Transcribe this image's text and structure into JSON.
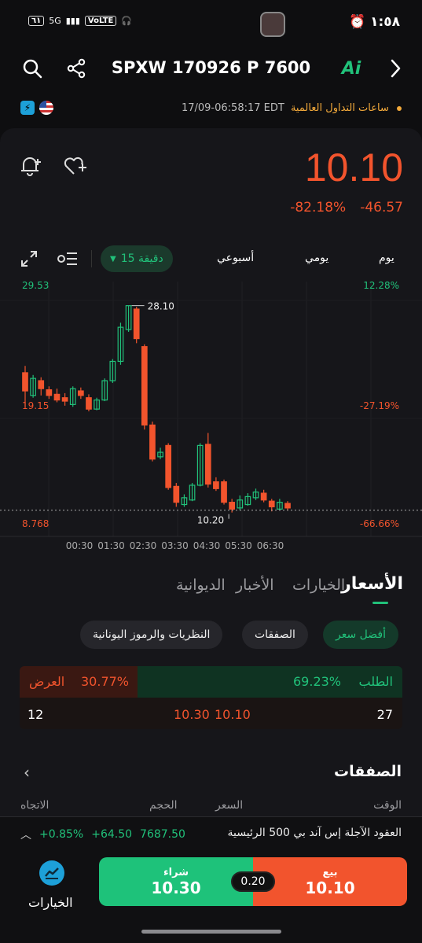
{
  "status_bar": {
    "time": "١:٥٨",
    "battery": "٦١",
    "network": "5G",
    "volte": "VoLTE"
  },
  "header": {
    "title": "SPXW 170926 P 7600",
    "ai_label": "Ai"
  },
  "market": {
    "status": "ساعات التداول العالمية",
    "timestamp": "17/09-06:58:17 EDT"
  },
  "quote": {
    "price": "10.10",
    "change": "-46.57",
    "change_pct": "-82.18%"
  },
  "chart_controls": {
    "active_timeframe": "15 دقيقة",
    "timeframes": [
      "يوم",
      "يومي",
      "أسبوعي"
    ]
  },
  "chart_data": {
    "type": "candlestick",
    "y_left_labels": [
      "29.53",
      "19.15",
      "8.768"
    ],
    "y_right_labels": [
      "12.28%",
      "-27.19%",
      "-66.66%"
    ],
    "x_labels": [
      "00:30",
      "01:30",
      "02:30",
      "03:30",
      "04:30",
      "05:30",
      "06:30"
    ],
    "high_marker": "28.10",
    "low_marker": "10.20",
    "last_price": 10.1,
    "ylim": [
      8.768,
      29.53
    ],
    "candles": [
      {
        "o": 22.2,
        "c": 20.6,
        "h": 22.8,
        "l": 19.2
      },
      {
        "o": 20.2,
        "c": 21.7,
        "h": 22.0,
        "l": 20.0
      },
      {
        "o": 21.5,
        "c": 20.8,
        "h": 21.8,
        "l": 20.2
      },
      {
        "o": 20.7,
        "c": 20.2,
        "h": 21.0,
        "l": 19.9
      },
      {
        "o": 20.3,
        "c": 19.8,
        "h": 20.8,
        "l": 19.6
      },
      {
        "o": 20.0,
        "c": 19.7,
        "h": 20.4,
        "l": 19.3
      },
      {
        "o": 19.4,
        "c": 20.8,
        "h": 21.0,
        "l": 19.2
      },
      {
        "o": 20.6,
        "c": 20.2,
        "h": 20.9,
        "l": 19.9
      },
      {
        "o": 20.0,
        "c": 19.0,
        "h": 20.3,
        "l": 18.8
      },
      {
        "o": 19.0,
        "c": 19.8,
        "h": 20.0,
        "l": 18.9
      },
      {
        "o": 19.8,
        "c": 21.5,
        "h": 21.7,
        "l": 19.7
      },
      {
        "o": 21.5,
        "c": 23.2,
        "h": 23.4,
        "l": 21.3
      },
      {
        "o": 23.2,
        "c": 26.2,
        "h": 26.6,
        "l": 22.9
      },
      {
        "o": 26.0,
        "c": 28.1,
        "h": 28.1,
        "l": 25.8
      },
      {
        "o": 27.8,
        "c": 25.2,
        "h": 28.0,
        "l": 24.8
      },
      {
        "o": 24.5,
        "c": 17.6,
        "h": 24.7,
        "l": 17.2
      },
      {
        "o": 17.6,
        "c": 14.6,
        "h": 17.9,
        "l": 14.4
      },
      {
        "o": 14.8,
        "c": 15.2,
        "h": 15.6,
        "l": 14.6
      },
      {
        "o": 15.8,
        "c": 12.1,
        "h": 16.0,
        "l": 11.9
      },
      {
        "o": 12.2,
        "c": 10.8,
        "h": 12.5,
        "l": 10.4
      },
      {
        "o": 10.6,
        "c": 11.2,
        "h": 11.5,
        "l": 10.4
      },
      {
        "o": 11.0,
        "c": 12.3,
        "h": 12.5,
        "l": 10.9
      },
      {
        "o": 12.3,
        "c": 15.8,
        "h": 16.0,
        "l": 12.2
      },
      {
        "o": 15.9,
        "c": 12.4,
        "h": 16.9,
        "l": 12.1
      },
      {
        "o": 12.6,
        "c": 12.0,
        "h": 13.0,
        "l": 11.8
      },
      {
        "o": 12.6,
        "c": 10.8,
        "h": 12.8,
        "l": 10.6
      },
      {
        "o": 10.8,
        "c": 10.2,
        "h": 11.1,
        "l": 9.9
      },
      {
        "o": 10.3,
        "c": 11.0,
        "h": 11.4,
        "l": 10.1
      },
      {
        "o": 10.6,
        "c": 11.3,
        "h": 11.6,
        "l": 10.5
      },
      {
        "o": 11.2,
        "c": 11.7,
        "h": 12.0,
        "l": 11.0
      },
      {
        "o": 11.6,
        "c": 11.0,
        "h": 11.9,
        "l": 10.8
      },
      {
        "o": 10.9,
        "c": 10.4,
        "h": 11.1,
        "l": 10.0
      },
      {
        "o": 10.2,
        "c": 10.8,
        "h": 11.1,
        "l": 10.1
      },
      {
        "o": 10.7,
        "c": 10.3,
        "h": 10.9,
        "l": 10.1
      }
    ],
    "colors": {
      "up": "#21c17a",
      "down": "#f2542d"
    }
  },
  "tabs": [
    "الأسعار",
    "الخيارات",
    "الأخبار",
    "الديوانية"
  ],
  "pills": [
    "أفضل سعر",
    "الصفقات",
    "النظريات والرموز اليونانية"
  ],
  "order_book": {
    "bid_label": "الطلب",
    "bid_pct": "69.23%",
    "ask_label": "العرض",
    "ask_pct": "30.77%",
    "bid_size": "27",
    "bid_price": "10.10",
    "ask_price": "10.30",
    "ask_size": "12"
  },
  "trades": {
    "title": "الصفقات",
    "columns": [
      "الوقت",
      "السعر",
      "الحجم",
      "الاتجاه"
    ]
  },
  "futures": {
    "name": "العقود الآجلة إس آند بي 500 الرئيسية",
    "price": "7687.50",
    "change": "+64.50",
    "change_pct": "+0.85%"
  },
  "actions": {
    "sell_label": "بيع",
    "sell_price": "10.10",
    "buy_label": "شراء",
    "buy_price": "10.30",
    "spread": "0.20",
    "options_label": "الخيارات"
  },
  "colors": {
    "accent_green": "#21c17a",
    "accent_red": "#f2542d",
    "background": "#0e0e10"
  }
}
